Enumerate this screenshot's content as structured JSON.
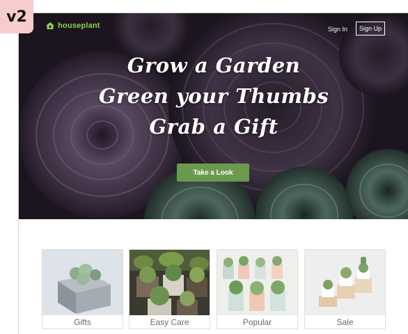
{
  "version_tag": "v2",
  "brand": {
    "name": "houseplant",
    "icon": "house-leaf-icon",
    "color": "#8fd14f"
  },
  "nav": {
    "sign_in": "Sign In",
    "sign_up": "Sign Up"
  },
  "hero": {
    "lines": [
      "Grow a Garden",
      "Green your Thumbs",
      "Grab a Gift"
    ],
    "cta_label": "Take a Look",
    "cta_color": "#6b9a4e"
  },
  "categories": [
    {
      "label": "Gifts"
    },
    {
      "label": "Easy Care"
    },
    {
      "label": "Popular"
    },
    {
      "label": "Sale"
    }
  ]
}
